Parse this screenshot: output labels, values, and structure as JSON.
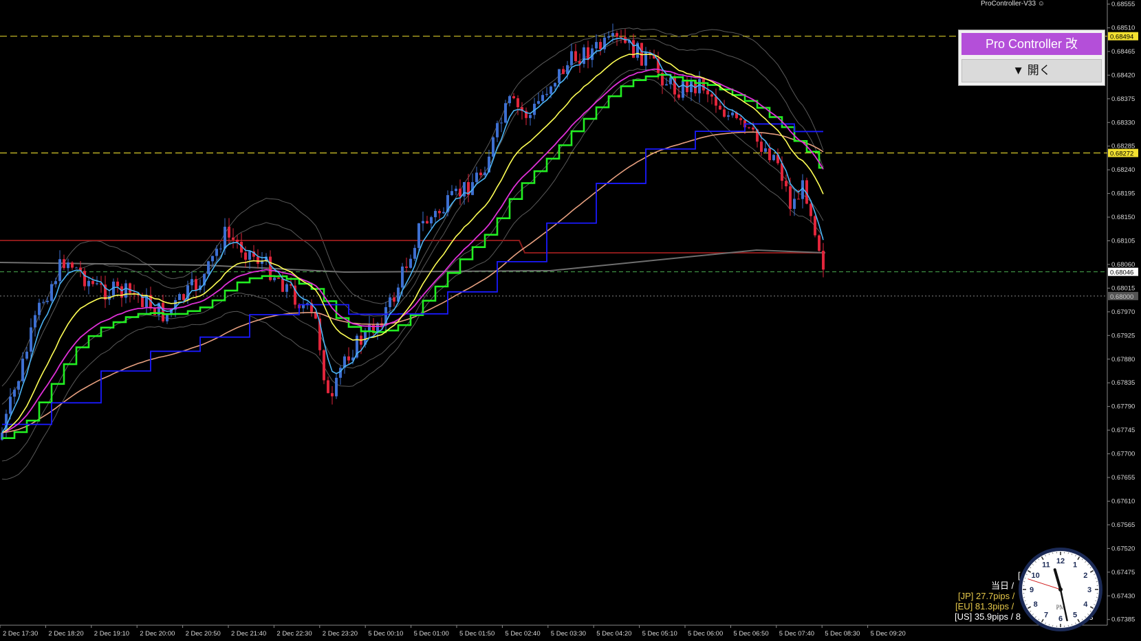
{
  "indicator_label": "ProController-V33 ☺",
  "colors": {
    "bull": "#3d6fd1",
    "bear": "#e0253b",
    "ema_fast": "#4cb4f5",
    "ema_mid": "#ffff55",
    "ema_slow": "#e030d8",
    "stair_green": "#22ee22",
    "stair_blue": "#1a1aff",
    "ma_long": "#e8a080",
    "hline_yellow": "#d4c72a",
    "hline_red": "#8a1a1a"
  },
  "y_axis": [
    "0.68555",
    "0.68510",
    "0.68465",
    "0.68420",
    "0.68375",
    "0.68330",
    "0.68285",
    "0.68240",
    "0.68195",
    "0.68150",
    "0.68105",
    "0.68060",
    "0.68015",
    "0.67970",
    "0.67925",
    "0.67880",
    "0.67835",
    "0.67790",
    "0.67745",
    "0.67700",
    "0.67655",
    "0.67610",
    "0.67565",
    "0.67520",
    "0.67475",
    "0.67430",
    "0.67385"
  ],
  "x_axis": [
    "2 Dec 17:30",
    "2 Dec 18:20",
    "2 Dec 19:10",
    "2 Dec 20:00",
    "2 Dec 20:50",
    "2 Dec 21:40",
    "2 Dec 22:30",
    "2 Dec 23:20",
    "5 Dec 00:10",
    "5 Dec 01:00",
    "5 Dec 01:50",
    "5 Dec 02:40",
    "5 Dec 03:30",
    "5 Dec 04:20",
    "5 Dec 05:10",
    "5 Dec 06:00",
    "5 Dec 06:50",
    "5 Dec 07:40",
    "5 Dec 08:30",
    "5 Dec 09:20"
  ],
  "price_labels": {
    "top_yellow": "0.68494",
    "mid_yellow": "0.68272",
    "current": "0.68046",
    "round": "0.68000"
  },
  "panel": {
    "title": "Pro Controller 改",
    "open_button": "▼ 開く"
  },
  "stats": {
    "line0": "[",
    "line1": "当日 /",
    "jp": "[JP] 27.7pips /",
    "eu": "[EU] 81.3pips /",
    "us": "[US] 35.9pips / 8",
    "us_suffix": "s"
  },
  "clock": {
    "period": "PM",
    "hour": 11,
    "minute": 28,
    "second": 48
  }
}
